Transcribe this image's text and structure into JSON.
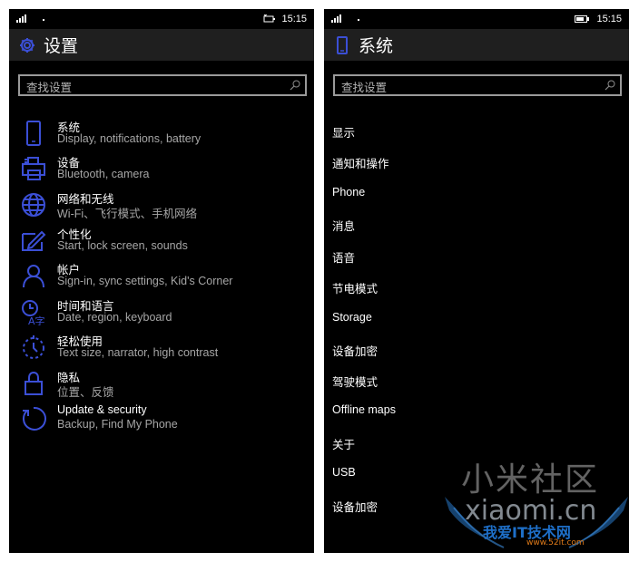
{
  "colors": {
    "accent": "#3b4fd6",
    "background": "#000000",
    "header": "#1f1f1f",
    "secondary_text": "#a6a6a6"
  },
  "left_screen": {
    "status": {
      "time": "15:15",
      "icons": [
        "signal-icon",
        "charging-icon"
      ]
    },
    "header": {
      "title": "设置",
      "icon": "gear-icon"
    },
    "search": {
      "placeholder": "查找设置"
    },
    "items": [
      {
        "title": "系统",
        "subtitle": "Display, notifications, battery",
        "icon": "phone-icon"
      },
      {
        "title": "设备",
        "subtitle": "Bluetooth, camera",
        "icon": "printer-icon"
      },
      {
        "title": "网络和无线",
        "subtitle": "Wi-Fi、飞行模式、手机网络",
        "icon": "globe-icon"
      },
      {
        "title": "个性化",
        "subtitle": "Start, lock screen, sounds",
        "icon": "personalize-icon"
      },
      {
        "title": "帐户",
        "subtitle": "Sign-in, sync settings, Kid's Corner",
        "icon": "person-icon"
      },
      {
        "title": "时间和语言",
        "subtitle": "Date, region, keyboard",
        "icon": "time-language-icon"
      },
      {
        "title": "轻松使用",
        "subtitle": "Text size, narrator, high contrast",
        "icon": "ease-of-access-icon"
      },
      {
        "title": "隐私",
        "subtitle": "位置、反馈",
        "icon": "lock-icon"
      },
      {
        "title": "Update & security",
        "subtitle": "Backup, Find My Phone",
        "icon": "update-icon"
      }
    ]
  },
  "right_screen": {
    "status": {
      "time": "15:15",
      "icons": [
        "signal-icon",
        "battery-icon"
      ]
    },
    "header": {
      "title": "系统",
      "icon": "phone-icon"
    },
    "search": {
      "placeholder": "查找设置"
    },
    "items": [
      "显示",
      "通知和操作",
      "Phone",
      "消息",
      "语音",
      "节电模式",
      "Storage",
      "设备加密",
      "驾驶模式",
      "Offline maps",
      "关于",
      "USB",
      "设备加密"
    ]
  },
  "watermark": {
    "line1": "小米社区",
    "line2": "xiaomi.cn",
    "line3": "我爱IT技术网",
    "line4": "www.52it.com"
  }
}
